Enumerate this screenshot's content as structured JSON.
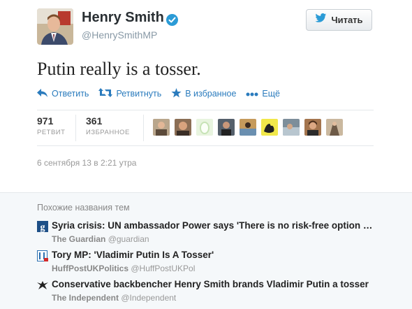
{
  "author": {
    "name": "Henry Smith",
    "handle": "@HenrySmithMP"
  },
  "follow_button": {
    "label": "Читать",
    "icon": "twitter-bird-icon"
  },
  "tweet": {
    "text": "Putin really is a tosser."
  },
  "actions": [
    {
      "label": "Ответить",
      "icon": "reply-icon"
    },
    {
      "label": "Ретвитнуть",
      "icon": "retweet-icon"
    },
    {
      "label": "В избранное",
      "icon": "star-icon"
    },
    {
      "label": "Ещё",
      "icon": "more-dots-icon"
    }
  ],
  "stats": {
    "retweets": {
      "count": "971",
      "label": "РЕТВИТ"
    },
    "favorites": {
      "count": "361",
      "label": "ИЗБРАННОЕ"
    }
  },
  "timestamp": "6 сентября 13 в 2:21 утра",
  "related": {
    "title": "Похожие названия тем",
    "stories": [
      {
        "headline": "Syria crisis: UN ambassador Power says 'There is no risk-free option on Syria'",
        "source_name": "The Guardian",
        "source_handle": "@guardian",
        "icon": "guardian-g-icon"
      },
      {
        "headline": "Tory MP: 'Vladimir Putin Is A Tosser'",
        "source_name": "HuffPostUKPolitics",
        "source_handle": "@HuffPostUKPol",
        "icon": "huffpost-icon"
      },
      {
        "headline": "Conservative backbencher Henry Smith brands Vladimir Putin a tosser",
        "source_name": "The Independent",
        "source_handle": "@Independent",
        "icon": "independent-eagle-icon"
      }
    ]
  },
  "colors": {
    "link": "#2a7bbd",
    "verified": "#2b9bd6",
    "muted": "#999999",
    "related_bg": "#f5f8fa"
  }
}
